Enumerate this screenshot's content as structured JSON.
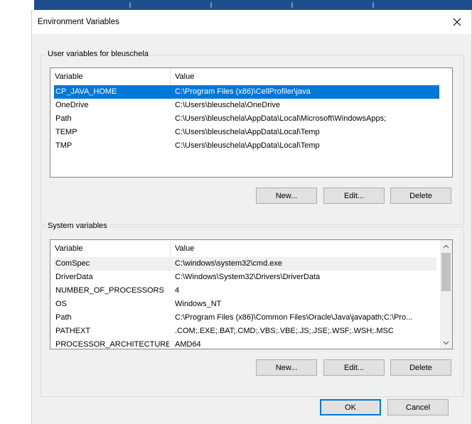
{
  "dialog": {
    "title": "Environment Variables",
    "close_glyph": "×"
  },
  "user_vars": {
    "group_label": "User variables for bleuschela",
    "columns": [
      "Variable",
      "Value"
    ],
    "selected_index": 0,
    "rows": [
      {
        "variable": "CP_JAVA_HOME",
        "value": "C:\\Program Files (x86)\\CellProfiler\\java"
      },
      {
        "variable": "OneDrive",
        "value": "C:\\Users\\bleuschela\\OneDrive"
      },
      {
        "variable": "Path",
        "value": "C:\\Users\\bleuschela\\AppData\\Local\\Microsoft\\WindowsApps;"
      },
      {
        "variable": "TEMP",
        "value": "C:\\Users\\bleuschela\\AppData\\Local\\Temp"
      },
      {
        "variable": "TMP",
        "value": "C:\\Users\\bleuschela\\AppData\\Local\\Temp"
      }
    ],
    "buttons": {
      "new": "New...",
      "edit": "Edit...",
      "delete": "Delete"
    }
  },
  "system_vars": {
    "group_label": "System variables",
    "columns": [
      "Variable",
      "Value"
    ],
    "focused_index": 0,
    "rows": [
      {
        "variable": "ComSpec",
        "value": "C:\\windows\\system32\\cmd.exe"
      },
      {
        "variable": "DriverData",
        "value": "C:\\Windows\\System32\\Drivers\\DriverData"
      },
      {
        "variable": "NUMBER_OF_PROCESSORS",
        "value": "4"
      },
      {
        "variable": "OS",
        "value": "Windows_NT"
      },
      {
        "variable": "Path",
        "value": "C:\\Program Files (x86)\\Common Files\\Oracle\\Java\\javapath;C:\\Pro..."
      },
      {
        "variable": "PATHEXT",
        "value": ".COM;.EXE;.BAT;.CMD;.VBS;.VBE;.JS;.JSE;.WSF;.WSH;.MSC"
      },
      {
        "variable": "PROCESSOR_ARCHITECTURE",
        "value": "AMD64"
      }
    ],
    "buttons": {
      "new": "New...",
      "edit": "Edit...",
      "delete": "Delete"
    }
  },
  "footer": {
    "ok": "OK",
    "cancel": "Cancel"
  },
  "colors": {
    "selection": "#0078d7",
    "accent": "#0078d7",
    "background_window": "#1f4e8c"
  }
}
